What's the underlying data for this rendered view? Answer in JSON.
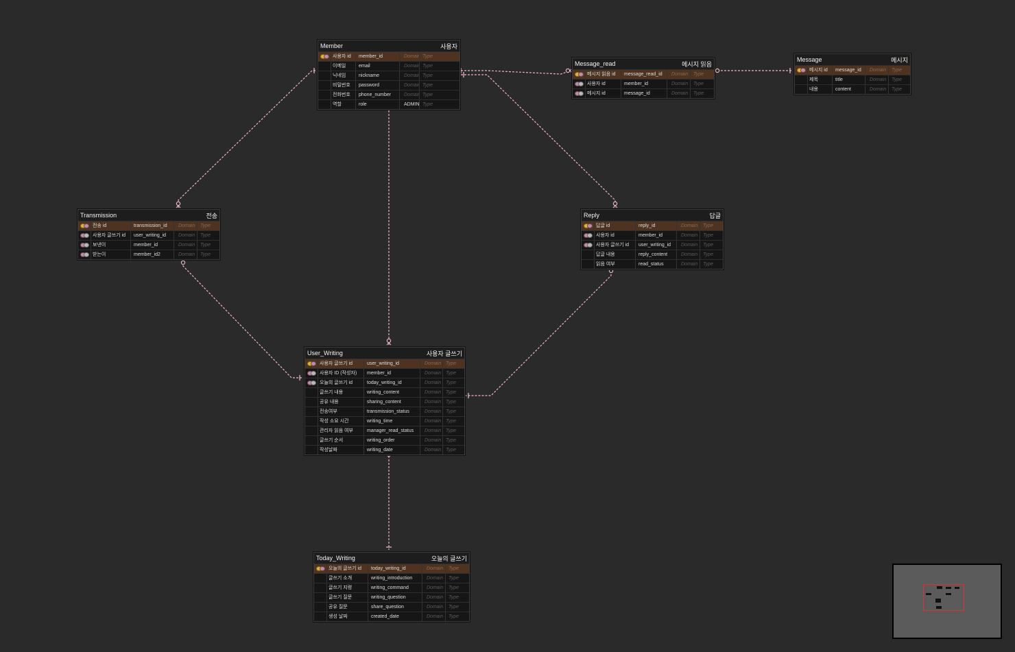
{
  "entities": [
    {
      "id": "member",
      "name": "Member",
      "korean": "사용자",
      "rows": [
        {
          "key": "pk",
          "logical": "사용자 id",
          "physical": "member_id",
          "domain": "Domain",
          "type": "Type"
        },
        {
          "key": "",
          "logical": "이메일",
          "physical": "email",
          "domain": "Domain",
          "type": "Type"
        },
        {
          "key": "",
          "logical": "닉네임",
          "physical": "nickname",
          "domain": "Domain",
          "type": "Type"
        },
        {
          "key": "",
          "logical": "비밀번호",
          "physical": "password",
          "domain": "Domain",
          "type": "Type"
        },
        {
          "key": "",
          "logical": "전화번호",
          "physical": "phone_number",
          "domain": "Domain",
          "type": "Type"
        },
        {
          "key": "",
          "logical": "역할",
          "physical": "role",
          "domain": "ADMIN,USER",
          "type": "Type"
        }
      ]
    },
    {
      "id": "message_read",
      "name": "Message_read",
      "korean": "메시지 읽음",
      "rows": [
        {
          "key": "pk",
          "logical": "메시지 읽음 id",
          "physical": "message_read_id",
          "domain": "Domain",
          "type": "Type"
        },
        {
          "key": "fk",
          "logical": "사용자 id",
          "physical": "member_id",
          "domain": "Domain",
          "type": "Type"
        },
        {
          "key": "fk",
          "logical": "메시지 id",
          "physical": "message_id",
          "domain": "Domain",
          "type": "Type"
        }
      ]
    },
    {
      "id": "message",
      "name": "Message",
      "korean": "메시지",
      "rows": [
        {
          "key": "pk",
          "logical": "메시지 id",
          "physical": "message_id",
          "domain": "Domain",
          "type": "Type"
        },
        {
          "key": "",
          "logical": "제목",
          "physical": "title",
          "domain": "Domain",
          "type": "Type"
        },
        {
          "key": "",
          "logical": "내용",
          "physical": "content",
          "domain": "Domain",
          "type": "Type"
        }
      ]
    },
    {
      "id": "transmission",
      "name": "Transmission",
      "korean": "전송",
      "rows": [
        {
          "key": "pk",
          "logical": "전송 id",
          "physical": "transmission_id",
          "domain": "Domain",
          "type": "Type"
        },
        {
          "key": "fk",
          "logical": "사용자 글쓰기 id",
          "physical": "user_writing_id",
          "domain": "Domain",
          "type": "Type"
        },
        {
          "key": "fk",
          "logical": "보낸이",
          "physical": "member_id",
          "domain": "Domain",
          "type": "Type"
        },
        {
          "key": "fk",
          "logical": "받는이",
          "physical": "member_id2",
          "domain": "Domain",
          "type": "Type"
        }
      ]
    },
    {
      "id": "reply",
      "name": "Reply",
      "korean": "답글",
      "rows": [
        {
          "key": "pk",
          "logical": "답글 id",
          "physical": "reply_id",
          "domain": "Domain",
          "type": "Type"
        },
        {
          "key": "fk",
          "logical": "사용자 id",
          "physical": "member_id",
          "domain": "Domain",
          "type": "Type"
        },
        {
          "key": "fk",
          "logical": "사용자 글쓰기 id",
          "physical": "user_writing_id",
          "domain": "Domain",
          "type": "Type"
        },
        {
          "key": "",
          "logical": "답글 내용",
          "physical": "reply_content",
          "domain": "Domain",
          "type": "Type"
        },
        {
          "key": "",
          "logical": "읽음 여부",
          "physical": "read_status",
          "domain": "Domain",
          "type": "Type"
        }
      ]
    },
    {
      "id": "user_writing",
      "name": "User_Writing",
      "korean": "사용자 글쓰기",
      "rows": [
        {
          "key": "pk",
          "logical": "사용자 글쓰기 id",
          "physical": "user_writing_id",
          "domain": "Domain",
          "type": "Type"
        },
        {
          "key": "fk",
          "logical": "사용자 ID (작성자)",
          "physical": "member_id",
          "domain": "Domain",
          "type": "Type"
        },
        {
          "key": "fk",
          "logical": "오늘의 글쓰기 id",
          "physical": "today_writing_id",
          "domain": "Domain",
          "type": "Type"
        },
        {
          "key": "",
          "logical": "글쓰기 내용",
          "physical": "writing_content",
          "domain": "Domain",
          "type": "Type"
        },
        {
          "key": "",
          "logical": "공유 내용",
          "physical": "sharing_content",
          "domain": "Domain",
          "type": "Type"
        },
        {
          "key": "",
          "logical": "전송여부",
          "physical": "transmission_status",
          "domain": "Domain",
          "type": "Type"
        },
        {
          "key": "",
          "logical": "작성 소요 시간",
          "physical": "writing_time",
          "domain": "Domain",
          "type": "Type"
        },
        {
          "key": "",
          "logical": "관리자 읽음 여부",
          "physical": "manager_read_status",
          "domain": "Domain",
          "type": "Type"
        },
        {
          "key": "",
          "logical": "글쓰기 순서",
          "physical": "writing_order",
          "domain": "Domain",
          "type": "Type"
        },
        {
          "key": "",
          "logical": "작성날짜",
          "physical": "writing_date",
          "domain": "Domain",
          "type": "Type"
        }
      ]
    },
    {
      "id": "today_writing",
      "name": "Today_Writing",
      "korean": "오늘의 글쓰기",
      "rows": [
        {
          "key": "pk",
          "logical": "오늘의 글쓰기 id",
          "physical": "today_writing_id",
          "domain": "Domain",
          "type": "Type"
        },
        {
          "key": "",
          "logical": "글쓰기 소개",
          "physical": "writing_introduction",
          "domain": "Domain",
          "type": "Type"
        },
        {
          "key": "",
          "logical": "글쓰기 지령",
          "physical": "writing_command",
          "domain": "Domain",
          "type": "Type"
        },
        {
          "key": "",
          "logical": "글쓰기 질문",
          "physical": "writing_question",
          "domain": "Domain",
          "type": "Type"
        },
        {
          "key": "",
          "logical": "공유 질문",
          "physical": "share_question",
          "domain": "Domain",
          "type": "Type"
        },
        {
          "key": "",
          "logical": "생성 날짜",
          "physical": "created_date",
          "domain": "Domain",
          "type": "Type"
        }
      ]
    }
  ],
  "relationships": [
    {
      "from": "member",
      "to": "message_read",
      "parent_end": "one",
      "child_end": "zero-or-many"
    },
    {
      "from": "message",
      "to": "message_read",
      "parent_end": "one",
      "child_end": "zero-or-many"
    },
    {
      "from": "member",
      "to": "transmission",
      "parent_end": "one",
      "child_end": "zero-or-many"
    },
    {
      "from": "member",
      "to": "user_writing",
      "parent_end": "one",
      "child_end": "zero-or-many"
    },
    {
      "from": "member",
      "to": "reply",
      "parent_end": "one",
      "child_end": "zero-or-many"
    },
    {
      "from": "user_writing",
      "to": "transmission",
      "parent_end": "one",
      "child_end": "zero-or-many"
    },
    {
      "from": "user_writing",
      "to": "reply",
      "parent_end": "one",
      "child_end": "zero-or-many"
    },
    {
      "from": "today_writing",
      "to": "user_writing",
      "parent_end": "one",
      "child_end": "zero-or-many"
    }
  ],
  "colors": {
    "background": "#2a2a2a",
    "entity_body": "#161616",
    "pk_row": "#4d3320",
    "link": "#e9b6c6",
    "minimap_view": "#e03030"
  }
}
